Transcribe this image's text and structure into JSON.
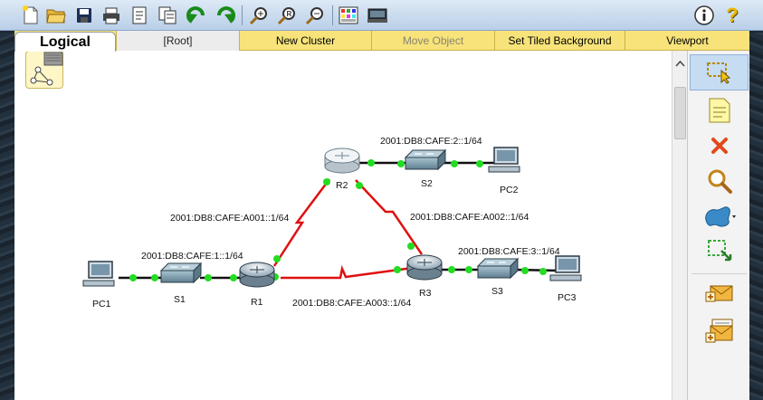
{
  "toolbar": {
    "buttons": [
      "new-icon",
      "open-icon",
      "save-icon",
      "print-icon",
      "activity-wizard-icon",
      "copy-icon",
      "undo-icon",
      "redo-icon",
      "zoom-in-icon",
      "zoom-reset-icon",
      "zoom-out-icon",
      "palette-icon",
      "device-dialog-icon",
      "info-icon",
      "help-icon"
    ],
    "help_label": "?"
  },
  "tabs": {
    "logical": "Logical",
    "root": "[Root]",
    "new_cluster": "New Cluster",
    "move_object": "Move Object",
    "set_tiled_background": "Set Tiled Background",
    "viewport": "Viewport"
  },
  "topology": {
    "devices": [
      {
        "id": "PC1",
        "label": "PC1",
        "type": "pc"
      },
      {
        "id": "S1",
        "label": "S1",
        "type": "switch"
      },
      {
        "id": "R1",
        "label": "R1",
        "type": "router"
      },
      {
        "id": "R2",
        "label": "R2",
        "type": "router"
      },
      {
        "id": "S2",
        "label": "S2",
        "type": "switch"
      },
      {
        "id": "PC2",
        "label": "PC2",
        "type": "pc"
      },
      {
        "id": "R3",
        "label": "R3",
        "type": "router"
      },
      {
        "id": "S3",
        "label": "S3",
        "type": "switch"
      },
      {
        "id": "PC3",
        "label": "PC3",
        "type": "pc"
      }
    ],
    "networks": {
      "lan1": "2001:DB8:CAFE:1::1/64",
      "lan2": "2001:DB8:CAFE:2::1/64",
      "lan3": "2001:DB8:CAFE:3::1/64",
      "r1r2": "2001:DB8:CAFE:A001::1/64",
      "r2r3": "2001:DB8:CAFE:A002::1/64",
      "r1r3": "2001:DB8:CAFE:A003::1/64"
    },
    "link_status_color": "#22dd22",
    "serial_link_color": "#e01010",
    "ethernet_link_color": "#111111"
  },
  "palette": {
    "items": [
      "select-icon",
      "note-icon",
      "delete-icon",
      "inspect-icon",
      "draw-shape-icon",
      "resize-icon",
      "add-simple-pdu-icon",
      "add-complex-pdu-icon"
    ]
  }
}
